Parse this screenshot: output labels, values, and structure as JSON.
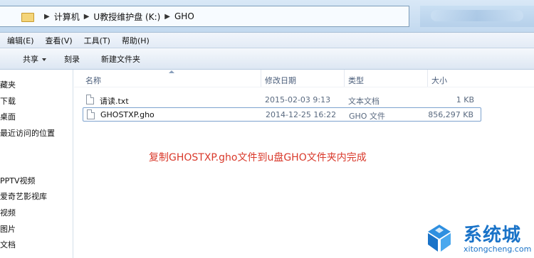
{
  "address_bar": {
    "crumbs": [
      "计算机",
      "U教授维护盘 (K:)",
      "GHO"
    ]
  },
  "menu": [
    "编辑(E)",
    "查看(V)",
    "工具(T)",
    "帮助(H)"
  ],
  "toolbar": {
    "share_label": "共享",
    "burn_label": "刻录",
    "new_folder_label": "新建文件夹"
  },
  "nav_pane": {
    "items": [
      "藏夹",
      "下载",
      "桌面",
      "最近访问的位置",
      "PPTV视频",
      "爱奇艺影视库",
      "视频",
      "图片",
      "文档"
    ]
  },
  "columns": {
    "name": "名称",
    "modified": "修改日期",
    "type": "类型",
    "size": "大小"
  },
  "files": [
    {
      "name": "请读.txt",
      "modified": "2015-02-03 9:13",
      "type": "文本文档",
      "size": "1 KB"
    },
    {
      "name": "GHOSTXP.gho",
      "modified": "2014-12-25 16:22",
      "type": "GHO 文件",
      "size": "856,297 KB"
    }
  ],
  "annotation_text": "复制GHOSTXP.gho文件到u盘GHO文件夹内完成",
  "watermark": {
    "title": "系统城",
    "url": "xitongcheng.com"
  },
  "colors": {
    "annotation": "#d9392b",
    "watermark": "#1a73c8",
    "selection_border": "#7da2ce"
  }
}
